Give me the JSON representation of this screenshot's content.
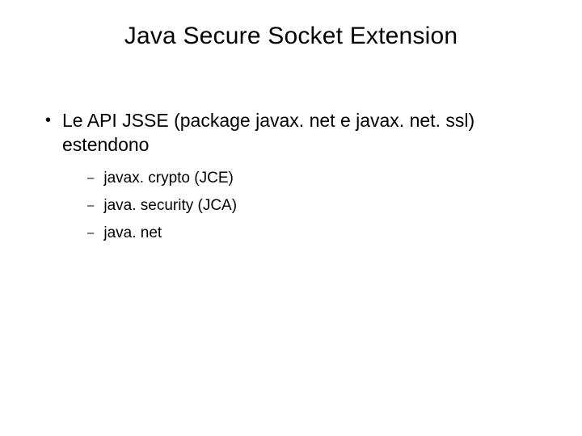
{
  "title": "Java Secure Socket Extension",
  "bullet": {
    "dot": "•",
    "text": "Le API JSSE (package javax. net e javax. net. ssl) estendono"
  },
  "subs": {
    "dash": "–",
    "items": [
      "javax. crypto (JCE)",
      "java. security (JCA)",
      "java. net"
    ]
  }
}
